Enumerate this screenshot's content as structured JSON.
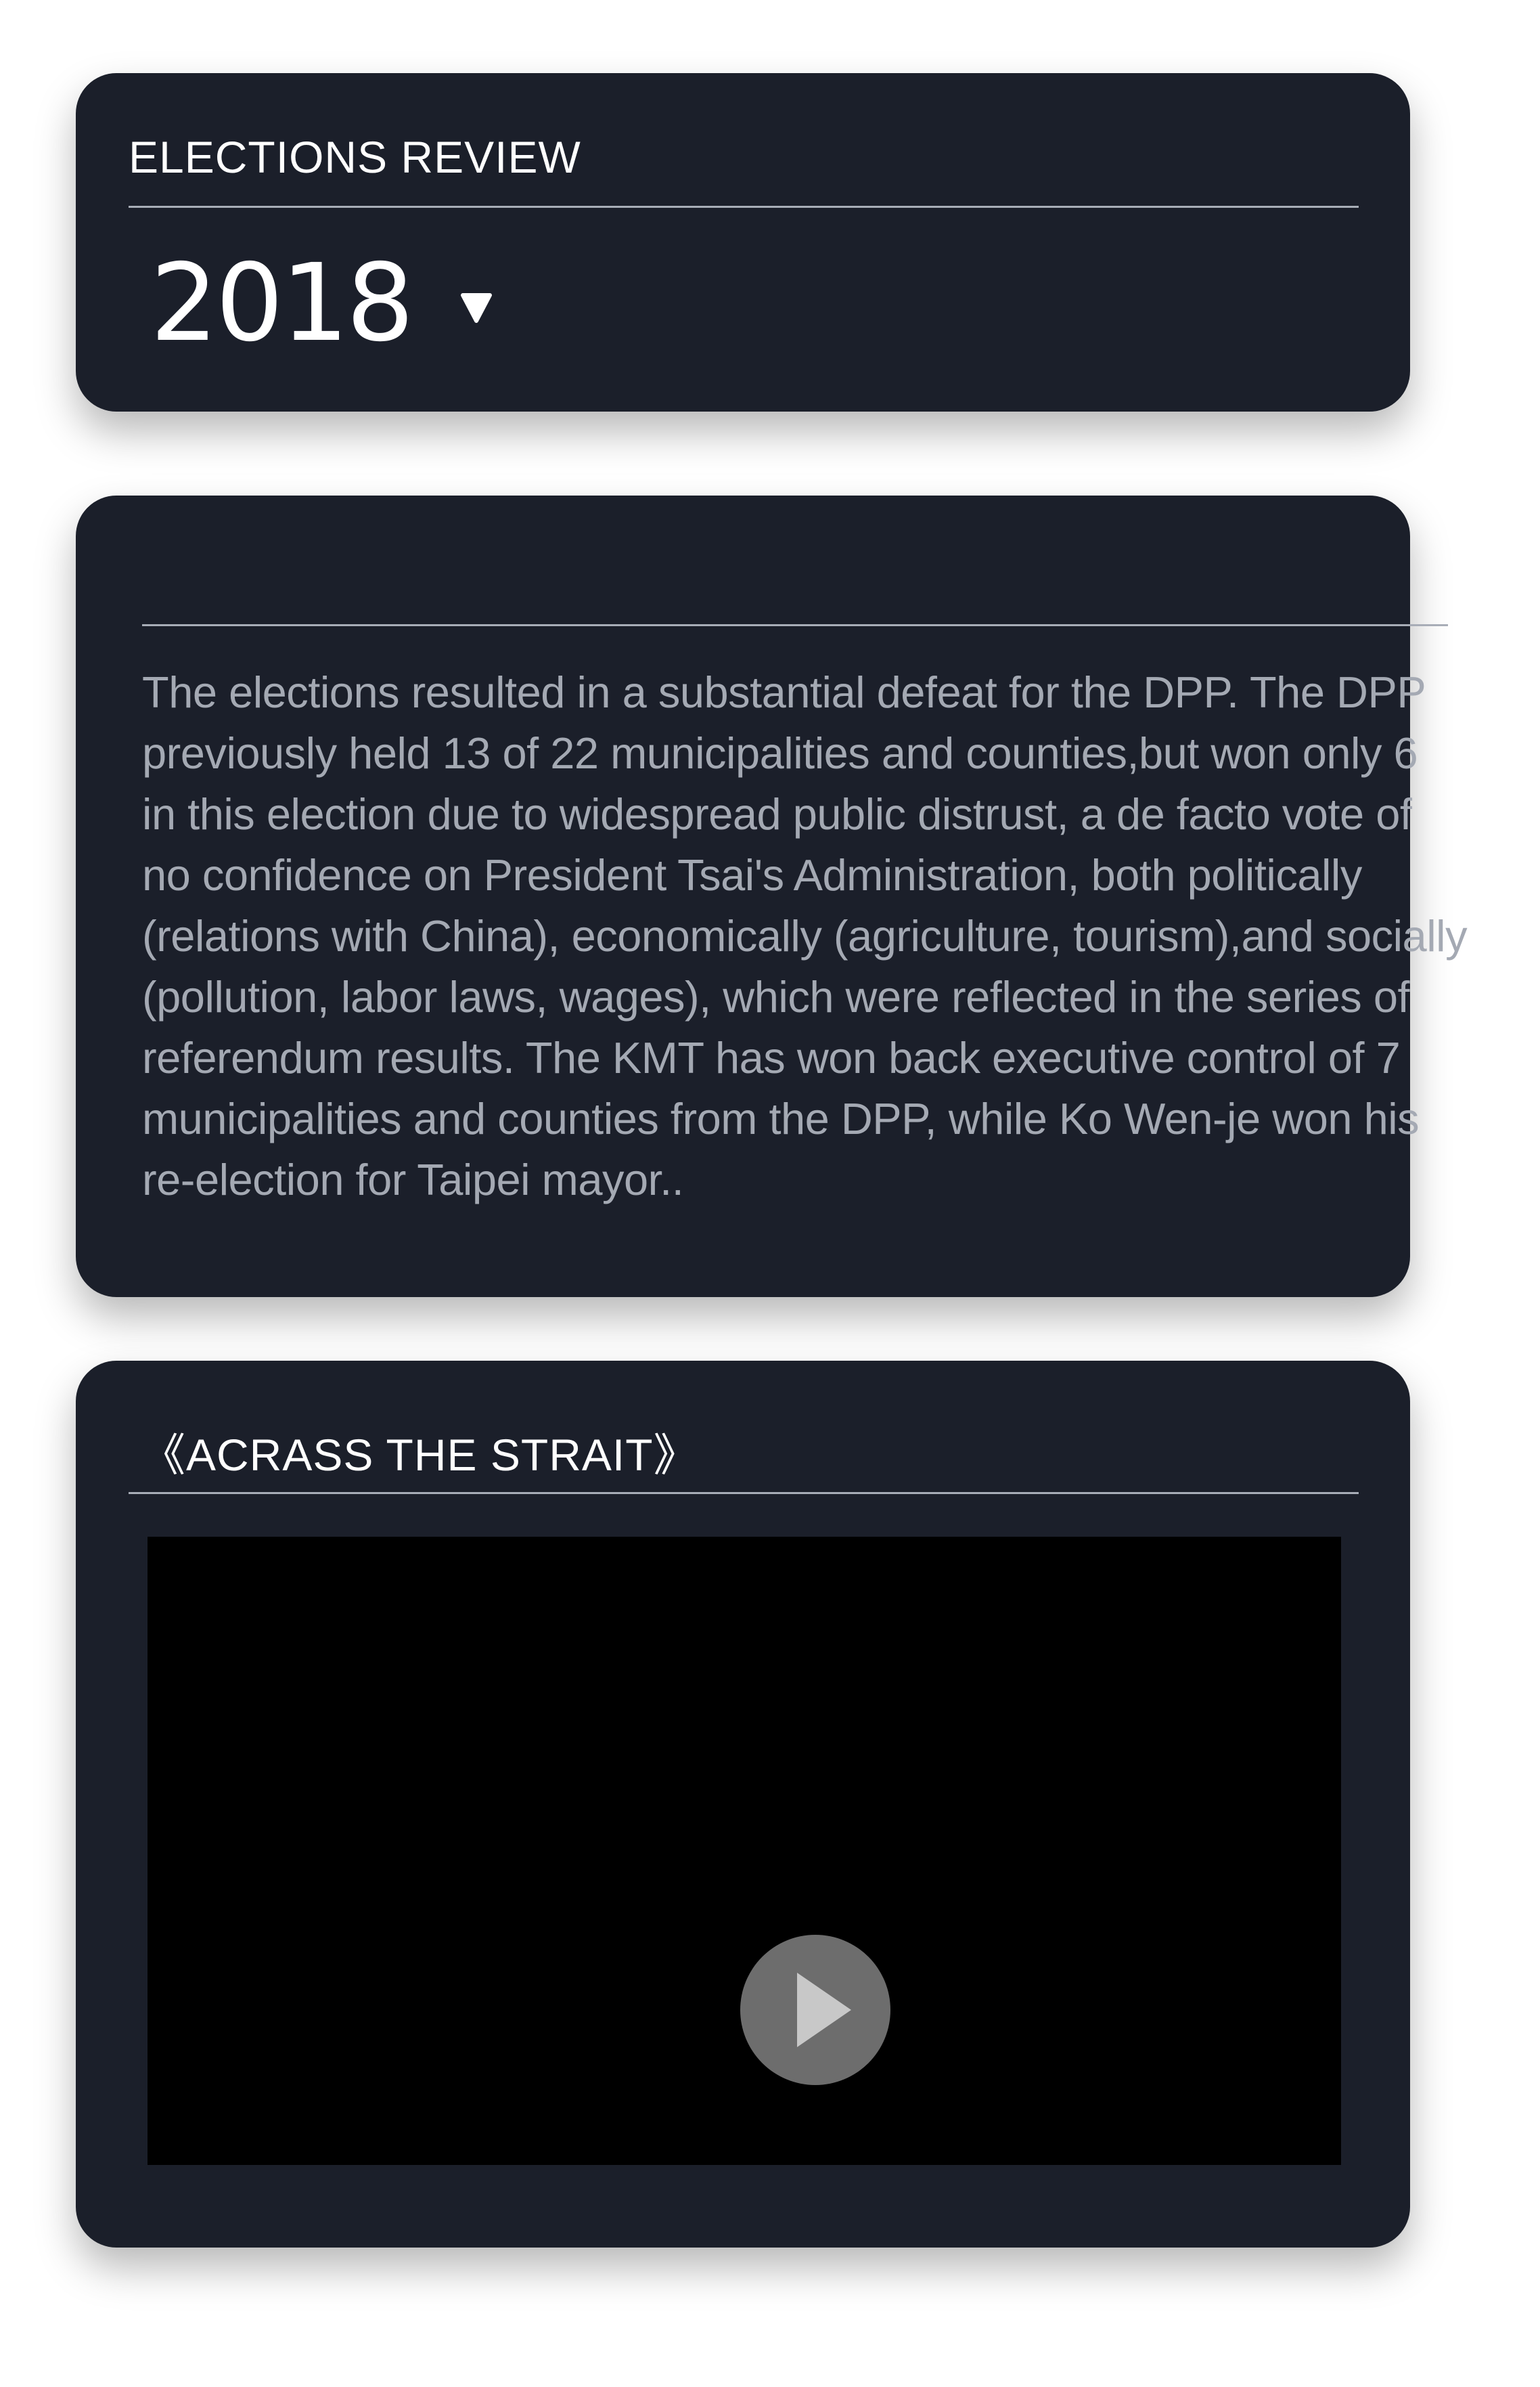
{
  "year_card": {
    "title": "ELECTIONS  REVIEW",
    "selected_year": "2018"
  },
  "summary_card": {
    "lines": [
      "The elections resulted in a substantial defeat for the DPP. The DPP",
      "previously held 13 of 22 municipalities and counties,but won only 6",
      "in this election due to widespread public distrust, a de facto vote of",
      "no confidence on President Tsai's Administration, both politically",
      " (relations with China), economically (agriculture, tourism),and socially",
      "(pollution, labor laws, wages), which were reflected in the series of",
      "referendum results. The KMT has won back executive control of 7",
      "municipalities and counties from the DPP, while Ko Wen-je won his",
      "re-election for Taipei mayor.."
    ]
  },
  "video_card": {
    "title": "《ACRASS THE STRAIT》",
    "play_icon": "play-icon"
  },
  "colors": {
    "card_background": "#1b1f2a",
    "divider": "#a8adb7",
    "body_text": "#a4a9b3",
    "video_background": "#000000",
    "play_button": "#6d6d6d"
  }
}
